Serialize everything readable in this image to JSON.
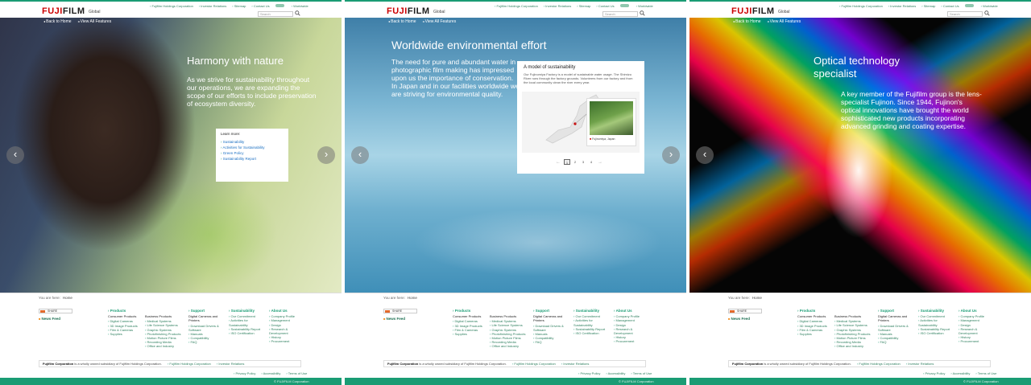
{
  "header": {
    "logo_text": "FUJIFILM",
    "region": "Global",
    "utility_links": [
      "Fujifilm Holdings Corporation",
      "Investor Relations",
      "Sitemap",
      "Contact Us",
      "Worldwide"
    ],
    "search_placeholder": "Search"
  },
  "hero_nav": {
    "back_home": "Back to Home",
    "view_all": "View All Features"
  },
  "panels": [
    {
      "title": "Harmony with nature",
      "body": "As we strive for sustainability throughout our operations, we are expanding the scope of our efforts to include preservation of ecosystem diversity.",
      "learn_more": {
        "heading": "Learn more:",
        "items": [
          "Sustainability",
          "Activities for Sustainability",
          "Green Policy",
          "Sustainability Report"
        ]
      }
    },
    {
      "title": "Worldwide environmental effort",
      "body": "The need for pure and abundant water in photographic film making has impressed upon us the importance of conservation. In Japan and in our facilities worldwide we are striving for environmental quality.",
      "model_card": {
        "title": "A model of sustainability",
        "text": "Our Fujinomiya Factory is a model of sustainable water usage. The Shimizu River runs through the factory grounds. Volunteers from our factory and from the local community clean the river every year.",
        "caption": "Fujinomiya, Japan",
        "pages": [
          "1",
          "2",
          "3",
          "4"
        ],
        "active_page": "1"
      }
    },
    {
      "title": "Optical technology specialist",
      "body": "A key member of the Fujifilm group is the lens-specialist Fujinon. Since 1944, Fujinon's optical innovations have brought the world sophisticated new products incorporating advanced grinding and coating expertise."
    }
  ],
  "footer": {
    "you_are_here": "You are here:",
    "home": "Home",
    "share": "SHARE",
    "news_feed": "News Feed",
    "columns": [
      {
        "heading": "Products",
        "groups": [
          {
            "sub": "Consumer Products",
            "items": [
              "Digital Cameras",
              "3D Image Products",
              "Film & Cameras",
              "Supplies"
            ]
          },
          {
            "sub": "Business Products",
            "items": [
              "Medical Systems",
              "Life Science Systems",
              "Graphic Systems",
              "Photofinishing Products",
              "Motion Picture Films",
              "Recording Media",
              "Office and Industry"
            ]
          }
        ]
      },
      {
        "heading": "Support",
        "groups": [
          {
            "sub": "Digital Cameras and Printers",
            "items": [
              "Download Drivers & Software",
              "Manuals",
              "Compatibility",
              "FAQ"
            ]
          }
        ]
      },
      {
        "heading": "Sustainability",
        "groups": [
          {
            "sub": "",
            "items": [
              "Our Commitment",
              "Activities for Sustainability",
              "Sustainability Report",
              "ISO Certification"
            ]
          }
        ]
      },
      {
        "heading": "About Us",
        "groups": [
          {
            "sub": "",
            "items": [
              "Company Profile",
              "Management",
              "Design",
              "Research & Development",
              "History",
              "Procurement"
            ]
          }
        ]
      }
    ],
    "corp_notice_bold": "Fujifilm Corporation",
    "corp_notice_rest": "is a wholly owned subsidiary of Fujifilm Holdings Corporation.",
    "corp_links": [
      "Fujifilm Holdings Corporation",
      "Investor Relations"
    ],
    "legal_links": [
      "Privacy Policy",
      "Accessibility",
      "Terms of Use"
    ],
    "copyright": "© FUJIFILM Corporation"
  },
  "colors": {
    "brand_green": "#1a9c74",
    "logo_red": "#cc0000"
  }
}
